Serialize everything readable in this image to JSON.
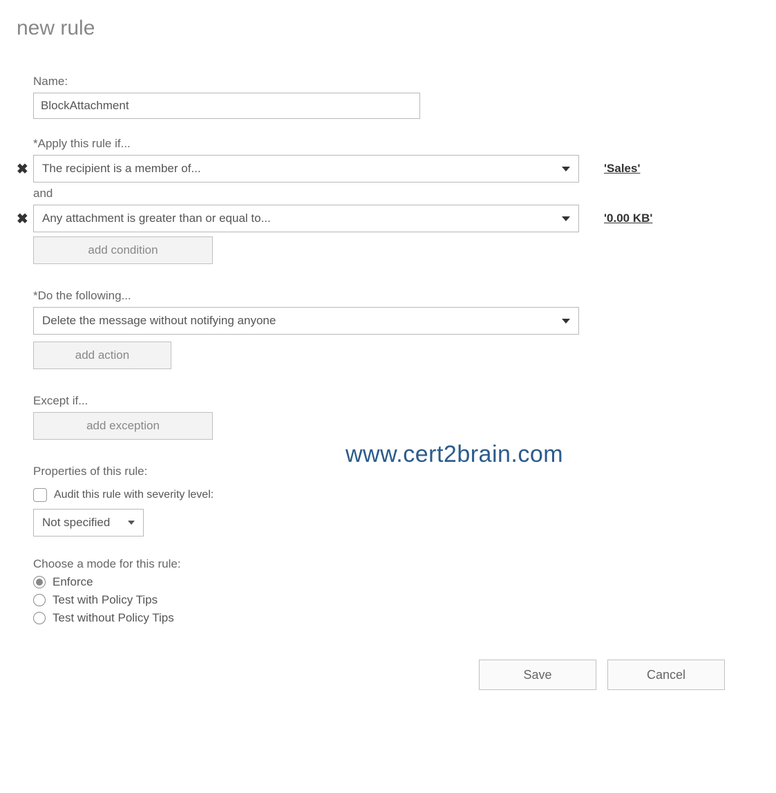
{
  "title": "new rule",
  "name_label": "Name:",
  "name_value": "BlockAttachment",
  "apply_label": "*Apply this rule if...",
  "conditions": [
    {
      "text": "The recipient is a member of...",
      "value": "'Sales'"
    },
    {
      "text": "Any attachment is greater than or equal to...",
      "value": "'0.00 KB'"
    }
  ],
  "and_text": "and",
  "add_condition": "add condition",
  "do_label": "*Do the following...",
  "action_text": "Delete the message without notifying anyone",
  "add_action": "add action",
  "except_label": "Except if...",
  "add_exception": "add exception",
  "properties_label": "Properties of this rule:",
  "audit_label": "Audit this rule with severity level:",
  "severity_value": "Not specified",
  "mode_label": "Choose a mode for this rule:",
  "modes": [
    {
      "label": "Enforce",
      "checked": true
    },
    {
      "label": "Test with Policy Tips",
      "checked": false
    },
    {
      "label": "Test without Policy Tips",
      "checked": false
    }
  ],
  "watermark": "www.cert2brain.com",
  "save": "Save",
  "cancel": "Cancel"
}
